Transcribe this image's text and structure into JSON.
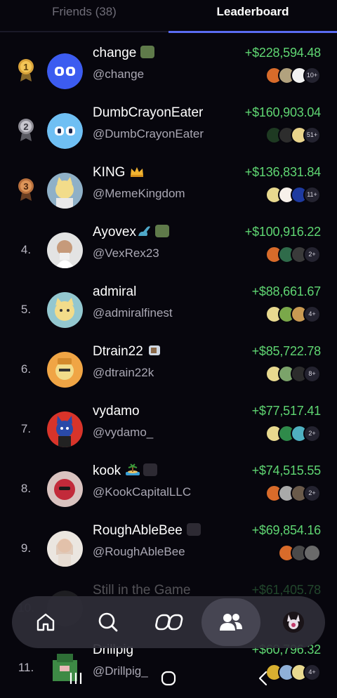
{
  "tabs": {
    "friends": "Friends (38)",
    "leaderboard": "Leaderboard",
    "active": "leaderboard"
  },
  "colors": {
    "accent": "#5a6cf2",
    "gain": "#5fd672",
    "background": "#07060d"
  },
  "leaderboard": [
    {
      "rank": "1",
      "medal": "gold",
      "name": "change",
      "handle": "@change",
      "amount": "+$228,594.48",
      "more": "10+",
      "badges": [
        "green-square-emoji"
      ]
    },
    {
      "rank": "2",
      "medal": "silver",
      "name": "DumbCrayonEater",
      "handle": "@DumbCrayonEater",
      "amount": "+$160,903.04",
      "more": "51+",
      "badges": []
    },
    {
      "rank": "3",
      "medal": "bronze",
      "name": "KING",
      "handle": "@MemeKingdom",
      "amount": "+$136,831.84",
      "more": "11+",
      "badges": [
        "crown-emoji"
      ]
    },
    {
      "rank": "4.",
      "medal": "",
      "name": "Ayovex",
      "handle": "@VexRex23",
      "amount": "+$100,916.22",
      "more": "2+",
      "badges": [
        "dinosaur-emoji",
        "green-square-emoji"
      ]
    },
    {
      "rank": "5.",
      "medal": "",
      "name": "admiral",
      "handle": "@admiralfinest",
      "amount": "+$88,661.67",
      "more": "4+",
      "badges": []
    },
    {
      "rank": "6.",
      "medal": "",
      "name": "Dtrain22",
      "handle": "@dtrain22k",
      "amount": "+$85,722.78",
      "more": "8+",
      "badges": [
        "hourglass-emoji"
      ]
    },
    {
      "rank": "7.",
      "medal": "",
      "name": "vydamo",
      "handle": "@vydamo_",
      "amount": "+$77,517.41",
      "more": "2+",
      "badges": []
    },
    {
      "rank": "8.",
      "medal": "",
      "name": "kook",
      "handle": "@KookCapitalLLC",
      "amount": "+$74,515.55",
      "more": "2+",
      "badges": [
        "island-emoji",
        "dark-badge-emoji"
      ]
    },
    {
      "rank": "9.",
      "medal": "",
      "name": "RoughAbleBee",
      "handle": "@RoughAbleBee",
      "amount": "+$69,854.16",
      "more": "",
      "badges": [
        "dark-badge-emoji"
      ]
    },
    {
      "rank": "10.",
      "medal": "",
      "name": "Still in the Game",
      "handle": "",
      "amount": "+$61,405.78",
      "more": "",
      "badges": []
    },
    {
      "rank": "11.",
      "medal": "",
      "name": "Drillpig",
      "handle": "@Drillpig_",
      "amount": "+$60,796.32",
      "more": "4+",
      "badges": []
    }
  ],
  "bottom_nav": {
    "items": [
      "home-icon",
      "search-icon",
      "logo-icon",
      "friends-icon",
      "profile-avatar"
    ],
    "active": "friends-icon"
  },
  "system_nav": [
    "recents-icon",
    "home-circle-icon",
    "back-icon"
  ]
}
